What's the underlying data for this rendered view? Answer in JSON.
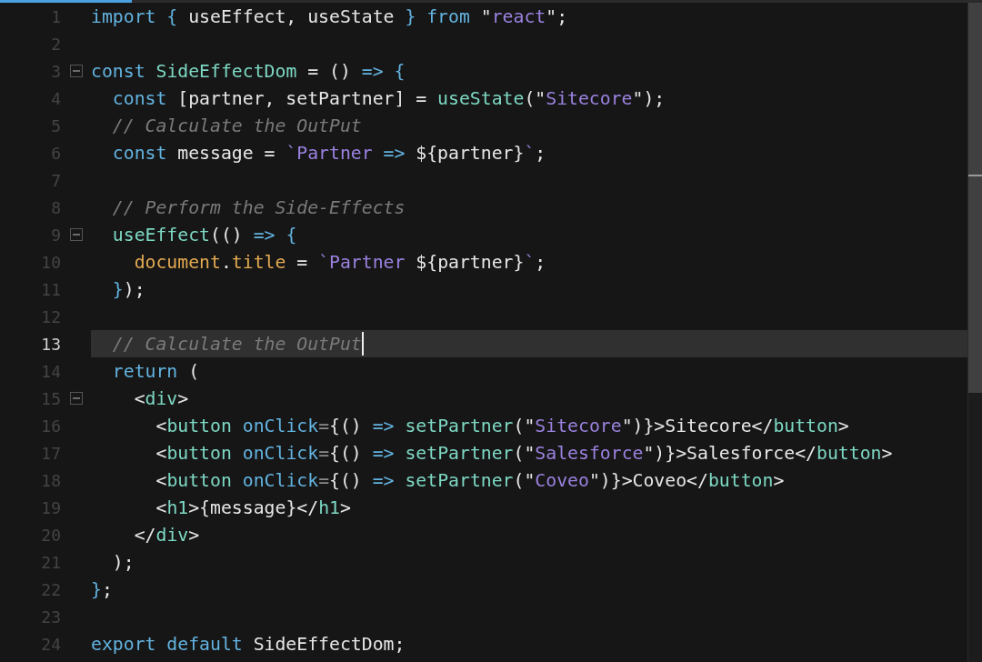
{
  "editor": {
    "lines": [
      {
        "number": "1",
        "fold": false,
        "current": false,
        "tokens": [
          {
            "kind": "kw",
            "text": "import {"
          },
          {
            "kind": "tx",
            "text": " useEffect, useState "
          },
          {
            "kind": "kw",
            "text": "} from "
          },
          {
            "kind": "tx",
            "text": "\""
          },
          {
            "kind": "st",
            "text": "react"
          },
          {
            "kind": "tx",
            "text": "\";"
          }
        ]
      },
      {
        "number": "2",
        "fold": false,
        "current": false
      },
      {
        "number": "3",
        "fold": true,
        "current": false,
        "tokens": [
          {
            "kind": "kw",
            "text": "const "
          },
          {
            "kind": "fn",
            "text": "SideEffectDom"
          },
          {
            "kind": "tx",
            "text": " = () "
          },
          {
            "kind": "kw",
            "text": "=> {"
          }
        ]
      },
      {
        "number": "4",
        "fold": false,
        "current": false,
        "tokens": [
          {
            "kind": "kw",
            "text": "  const "
          },
          {
            "kind": "tx",
            "text": "[partner, setPartner] = "
          },
          {
            "kind": "fn",
            "text": "useState"
          },
          {
            "kind": "tx",
            "text": "(\""
          },
          {
            "kind": "st",
            "text": "Sitecore"
          },
          {
            "kind": "tx",
            "text": "\");"
          }
        ]
      },
      {
        "number": "5",
        "fold": false,
        "current": false,
        "tokens": [
          {
            "kind": "cm",
            "text": "  // Calculate the OutPut"
          }
        ]
      },
      {
        "number": "6",
        "fold": false,
        "current": false,
        "tokens": [
          {
            "kind": "kw",
            "text": "  const "
          },
          {
            "kind": "tx",
            "text": "message = "
          },
          {
            "kind": "st",
            "text": "`Partner "
          },
          {
            "kind": "kw",
            "text": "=>"
          },
          {
            "kind": "tx",
            "text": " ${partner}"
          },
          {
            "kind": "st",
            "text": "`"
          },
          {
            "kind": "tx",
            "text": ";"
          }
        ]
      },
      {
        "number": "7",
        "fold": false,
        "current": false
      },
      {
        "number": "8",
        "fold": false,
        "current": false,
        "tokens": [
          {
            "kind": "cm",
            "text": "  // Perform the Side-Effects"
          }
        ]
      },
      {
        "number": "9",
        "fold": true,
        "current": false,
        "tokens": [
          {
            "kind": "fn",
            "text": "  useEffect"
          },
          {
            "kind": "tx",
            "text": "(() "
          },
          {
            "kind": "kw",
            "text": "=> {"
          }
        ]
      },
      {
        "number": "10",
        "fold": false,
        "current": false,
        "tokens": [
          {
            "kind": "pr",
            "text": "    document"
          },
          {
            "kind": "tx",
            "text": "."
          },
          {
            "kind": "pr",
            "text": "title"
          },
          {
            "kind": "tx",
            "text": " = "
          },
          {
            "kind": "st",
            "text": "`Partner "
          },
          {
            "kind": "tx",
            "text": "${partner}"
          },
          {
            "kind": "st",
            "text": "`"
          },
          {
            "kind": "tx",
            "text": ";"
          }
        ]
      },
      {
        "number": "11",
        "fold": false,
        "current": false,
        "tokens": [
          {
            "kind": "kw",
            "text": "  }"
          },
          {
            "kind": "tx",
            "text": ");"
          }
        ]
      },
      {
        "number": "12",
        "fold": false,
        "current": false
      },
      {
        "number": "13",
        "fold": false,
        "current": true,
        "tokens": [
          {
            "kind": "cm",
            "text": "  // Calculate the OutPut"
          }
        ]
      },
      {
        "number": "14",
        "fold": false,
        "current": false,
        "tokens": [
          {
            "kind": "kw",
            "text": "  return"
          },
          {
            "kind": "tx",
            "text": " ("
          }
        ]
      },
      {
        "number": "15",
        "fold": true,
        "current": false,
        "tokens": [
          {
            "kind": "tx",
            "text": "    <"
          },
          {
            "kind": "fn",
            "text": "div"
          },
          {
            "kind": "tx",
            "text": ">"
          }
        ]
      },
      {
        "number": "16",
        "fold": false,
        "current": false,
        "tokens": [
          {
            "kind": "tx",
            "text": "      <"
          },
          {
            "kind": "fn",
            "text": "button"
          },
          {
            "kind": "kw",
            "text": " onClick"
          },
          {
            "kind": "pn",
            "text": "="
          },
          {
            "kind": "tx",
            "text": "{() "
          },
          {
            "kind": "kw",
            "text": "=>"
          },
          {
            "kind": "fn",
            "text": " setPartner"
          },
          {
            "kind": "tx",
            "text": "(\""
          },
          {
            "kind": "st",
            "text": "Sitecore"
          },
          {
            "kind": "tx",
            "text": "\")}>Sitecore</"
          },
          {
            "kind": "fn",
            "text": "button"
          },
          {
            "kind": "tx",
            "text": ">"
          }
        ]
      },
      {
        "number": "17",
        "fold": false,
        "current": false,
        "tokens": [
          {
            "kind": "tx",
            "text": "      <"
          },
          {
            "kind": "fn",
            "text": "button"
          },
          {
            "kind": "kw",
            "text": " onClick"
          },
          {
            "kind": "pn",
            "text": "="
          },
          {
            "kind": "tx",
            "text": "{() "
          },
          {
            "kind": "kw",
            "text": "=>"
          },
          {
            "kind": "fn",
            "text": " setPartner"
          },
          {
            "kind": "tx",
            "text": "(\""
          },
          {
            "kind": "st",
            "text": "Salesforce"
          },
          {
            "kind": "tx",
            "text": "\")}>Salesforce</"
          },
          {
            "kind": "fn",
            "text": "button"
          },
          {
            "kind": "tx",
            "text": ">"
          }
        ]
      },
      {
        "number": "18",
        "fold": false,
        "current": false,
        "tokens": [
          {
            "kind": "tx",
            "text": "      <"
          },
          {
            "kind": "fn",
            "text": "button"
          },
          {
            "kind": "kw",
            "text": " onClick"
          },
          {
            "kind": "pn",
            "text": "="
          },
          {
            "kind": "tx",
            "text": "{() "
          },
          {
            "kind": "kw",
            "text": "=>"
          },
          {
            "kind": "fn",
            "text": " setPartner"
          },
          {
            "kind": "tx",
            "text": "(\""
          },
          {
            "kind": "st",
            "text": "Coveo"
          },
          {
            "kind": "tx",
            "text": "\")}>Coveo</"
          },
          {
            "kind": "fn",
            "text": "button"
          },
          {
            "kind": "tx",
            "text": ">"
          }
        ]
      },
      {
        "number": "19",
        "fold": false,
        "current": false,
        "tokens": [
          {
            "kind": "tx",
            "text": "      <"
          },
          {
            "kind": "fn",
            "text": "h1"
          },
          {
            "kind": "tx",
            "text": ">{message}</"
          },
          {
            "kind": "fn",
            "text": "h1"
          },
          {
            "kind": "tx",
            "text": ">"
          }
        ]
      },
      {
        "number": "20",
        "fold": false,
        "current": false,
        "tokens": [
          {
            "kind": "tx",
            "text": "    </"
          },
          {
            "kind": "fn",
            "text": "div"
          },
          {
            "kind": "tx",
            "text": ">"
          }
        ]
      },
      {
        "number": "21",
        "fold": false,
        "current": false,
        "tokens": [
          {
            "kind": "tx",
            "text": "  );"
          }
        ]
      },
      {
        "number": "22",
        "fold": false,
        "current": false,
        "tokens": [
          {
            "kind": "kw",
            "text": "}"
          },
          {
            "kind": "tx",
            "text": ";"
          }
        ]
      },
      {
        "number": "23",
        "fold": false,
        "current": false
      },
      {
        "number": "24",
        "fold": false,
        "current": false,
        "tokens": [
          {
            "kind": "kw",
            "text": "export default"
          },
          {
            "kind": "tx",
            "text": " SideEffectDom;"
          }
        ]
      }
    ]
  }
}
